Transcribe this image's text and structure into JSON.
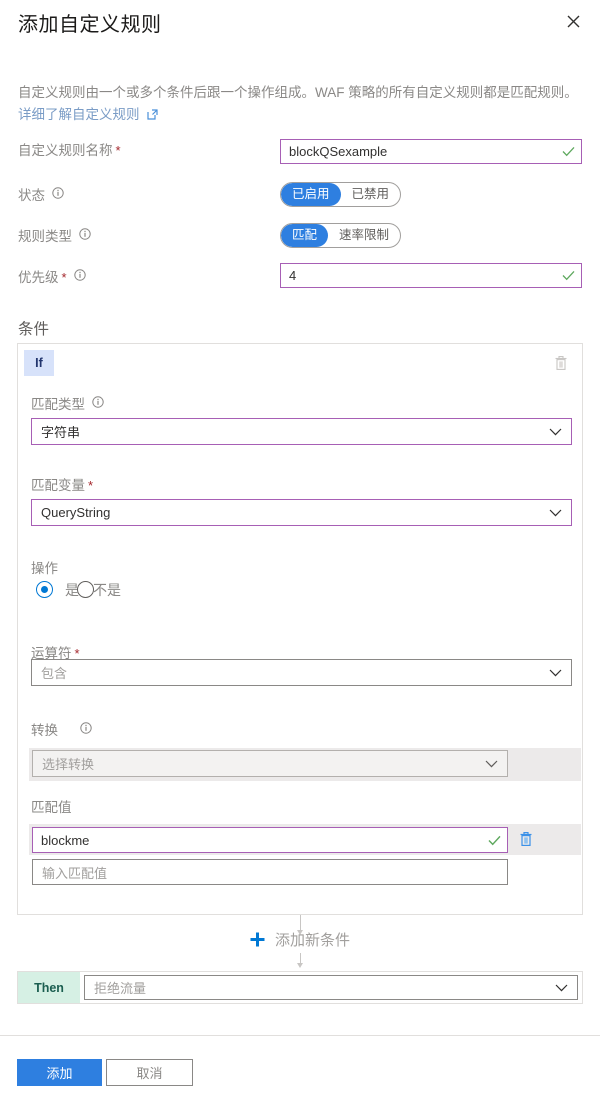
{
  "header": {
    "title": "添加自定义规则",
    "close_icon": "close-icon"
  },
  "description": {
    "text": "自定义规则由一个或多个条件后跟一个操作组成。WAF 策略的所有自定义规则都是匹配规则。",
    "link_text": "详细了解自定义规则",
    "external_icon": "external-link-icon"
  },
  "fields": {
    "rule_name": {
      "label": "自定义规则名称",
      "required_marker": "*",
      "value": "blockQSexample",
      "valid_icon": "checkmark-icon"
    },
    "state": {
      "label": "状态",
      "info_icon": "info-icon",
      "options": [
        "已启用",
        "已禁用"
      ],
      "selected": "已启用"
    },
    "rule_type": {
      "label": "规则类型",
      "info_icon": "info-icon",
      "options": [
        "匹配",
        "速率限制"
      ],
      "selected": "匹配"
    },
    "priority": {
      "label": "优先级",
      "required_marker": "*",
      "info_icon": "info-icon",
      "value": "4",
      "valid_icon": "checkmark-icon"
    }
  },
  "conditions_section": {
    "title": "条件",
    "if_badge": "If",
    "delete_icon": "trash-icon",
    "match_type": {
      "label": "匹配类型",
      "info_icon": "info-icon",
      "value": "字符串",
      "caret_icon": "chevron-down-icon"
    },
    "match_variable": {
      "label": "匹配变量",
      "required_marker": "*",
      "value": "QueryString",
      "caret_icon": "chevron-down-icon"
    },
    "operation": {
      "label": "操作",
      "options": [
        "是",
        "不是"
      ],
      "selected": "是"
    },
    "operator": {
      "label": "运算符",
      "required_marker": "*",
      "value": "包含",
      "caret_icon": "chevron-down-icon"
    },
    "transform": {
      "label": "转换",
      "info_icon": "info-icon",
      "placeholder": "选择转换",
      "caret_icon": "chevron-down-icon"
    },
    "match_value": {
      "label": "匹配值",
      "value": "blockme",
      "valid_icon": "checkmark-icon",
      "delete_icon": "trash-icon",
      "placeholder": "输入匹配值"
    }
  },
  "add_condition": {
    "label": "添加新条件",
    "plus_icon": "plus-icon"
  },
  "then_row": {
    "badge": "Then",
    "value": "拒绝流量",
    "caret_icon": "chevron-down-icon"
  },
  "footer": {
    "primary_label": "添加",
    "secondary_label": "取消"
  },
  "colors": {
    "accent_blue": "#2e7fe0",
    "field_border_purple": "#a75fb5",
    "valid_green": "#5ea85e",
    "required_red": "#a4262c",
    "if_badge_bg": "#d7e2fa",
    "then_badge_bg": "#d6f0e4"
  }
}
